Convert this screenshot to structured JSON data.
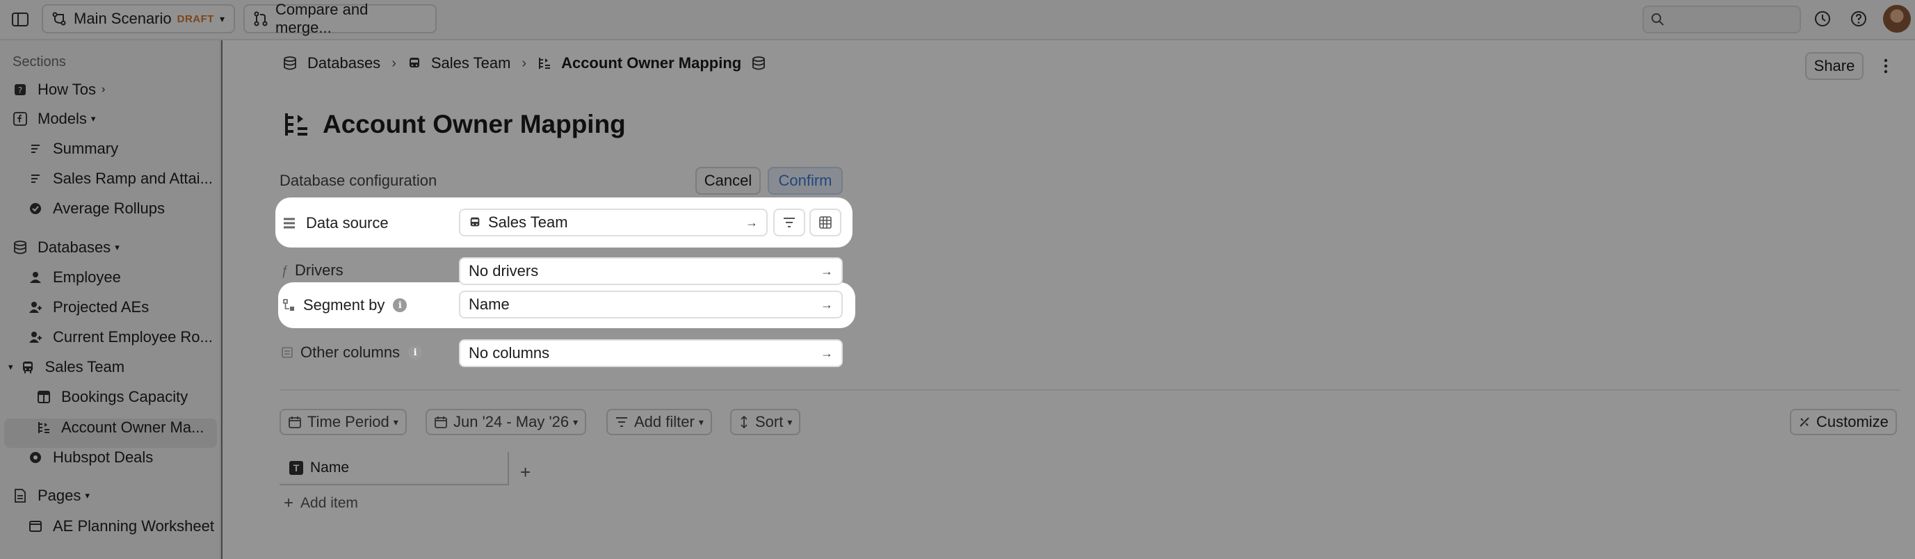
{
  "topbar": {
    "scenario_label": "Main Scenario",
    "draft_badge": "DRAFT",
    "compare_label": "Compare and merge...",
    "search_placeholder": ""
  },
  "sidebar": {
    "sections_label": "Sections",
    "how_tos": "How Tos",
    "models": "Models",
    "model_items": [
      "Summary",
      "Sales Ramp and Attai...",
      "Average Rollups"
    ],
    "databases": "Databases",
    "database_items": [
      "Employee",
      "Projected AEs",
      "Current Employee Ro..."
    ],
    "sales_team": "Sales Team",
    "sales_team_children": [
      "Bookings Capacity",
      "Account Owner Ma..."
    ],
    "hubspot": "Hubspot Deals",
    "pages": "Pages",
    "page_items": [
      "AE Planning Worksheet"
    ]
  },
  "breadcrumb": {
    "databases": "Databases",
    "sales_team": "Sales Team",
    "current": "Account Owner Mapping"
  },
  "header": {
    "share": "Share"
  },
  "page_title": "Account Owner Mapping",
  "config": {
    "label": "Database configuration",
    "cancel": "Cancel",
    "confirm": "Confirm",
    "data_source_label": "Data source",
    "data_source_value": "Sales Team",
    "drivers_label": "Drivers",
    "drivers_value": "No drivers",
    "segment_label": "Segment by",
    "segment_value": "Name",
    "other_label": "Other columns",
    "other_value": "No columns"
  },
  "filters": {
    "time_period": "Time Period",
    "date_range": "Jun '24 - May '26",
    "add_filter": "Add filter",
    "sort": "Sort",
    "customize": "Customize"
  },
  "table": {
    "column": "Name",
    "add_item": "Add item"
  },
  "colors": {
    "confirm": "#3b7bd8",
    "draft": "#d27a2f"
  }
}
